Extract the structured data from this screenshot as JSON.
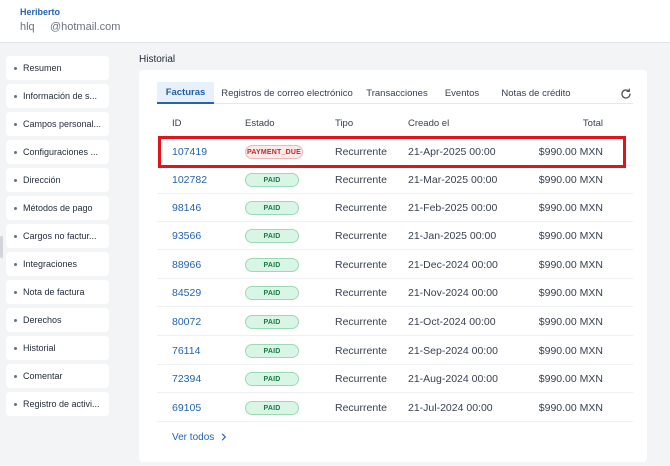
{
  "header": {
    "user_name": "Heriberto",
    "user_email": "hlq     @hotmail.com"
  },
  "sidebar": {
    "items": [
      {
        "label": "Resumen"
      },
      {
        "label": "Información de s..."
      },
      {
        "label": "Campos personal..."
      },
      {
        "label": "Configuraciones ..."
      },
      {
        "label": "Dirección"
      },
      {
        "label": "Métodos de pago"
      },
      {
        "label": "Cargos no factur..."
      },
      {
        "label": "Integraciones"
      },
      {
        "label": "Nota de factura"
      },
      {
        "label": "Derechos"
      },
      {
        "label": "Historial"
      },
      {
        "label": "Comentar"
      },
      {
        "label": "Registro de activi..."
      }
    ]
  },
  "main": {
    "section_title": "Historial",
    "tabs": [
      {
        "label": "Facturas",
        "active": true
      },
      {
        "label": "Registros de correo electrónico",
        "active": false
      },
      {
        "label": "Transacciones",
        "active": false
      },
      {
        "label": "Eventos",
        "active": false
      },
      {
        "label": "Notas de crédito",
        "active": false
      }
    ],
    "refresh_icon": "refresh-icon",
    "columns": {
      "id": "ID",
      "estado": "Estado",
      "tipo": "Tipo",
      "creado": "Creado el",
      "total": "Total"
    },
    "rows": [
      {
        "id": "107419",
        "estado": "PAYMENT_DUE",
        "tipo": "Recurrente",
        "creado": "21-Apr-2025 00:00",
        "total": "$990.00 MXN"
      },
      {
        "id": "102782",
        "estado": "PAID",
        "tipo": "Recurrente",
        "creado": "21-Mar-2025 00:00",
        "total": "$990.00 MXN"
      },
      {
        "id": "98146",
        "estado": "PAID",
        "tipo": "Recurrente",
        "creado": "21-Feb-2025 00:00",
        "total": "$990.00 MXN"
      },
      {
        "id": "93566",
        "estado": "PAID",
        "tipo": "Recurrente",
        "creado": "21-Jan-2025 00:00",
        "total": "$990.00 MXN"
      },
      {
        "id": "88966",
        "estado": "PAID",
        "tipo": "Recurrente",
        "creado": "21-Dec-2024 00:00",
        "total": "$990.00 MXN"
      },
      {
        "id": "84529",
        "estado": "PAID",
        "tipo": "Recurrente",
        "creado": "21-Nov-2024 00:00",
        "total": "$990.00 MXN"
      },
      {
        "id": "80072",
        "estado": "PAID",
        "tipo": "Recurrente",
        "creado": "21-Oct-2024 00:00",
        "total": "$990.00 MXN"
      },
      {
        "id": "76114",
        "estado": "PAID",
        "tipo": "Recurrente",
        "creado": "21-Sep-2024 00:00",
        "total": "$990.00 MXN"
      },
      {
        "id": "72394",
        "estado": "PAID",
        "tipo": "Recurrente",
        "creado": "21-Aug-2024 00:00",
        "total": "$990.00 MXN"
      },
      {
        "id": "69105",
        "estado": "PAID",
        "tipo": "Recurrente",
        "creado": "21-Jul-2024 00:00",
        "total": "$990.00 MXN"
      }
    ],
    "view_all": "Ver todos",
    "view_all_icon": "chevron-right-icon"
  },
  "colors": {
    "accent": "#2563b0",
    "paid_bg": "#d9f5e5",
    "due_text": "#c62828",
    "highlight": "#e0151b"
  }
}
